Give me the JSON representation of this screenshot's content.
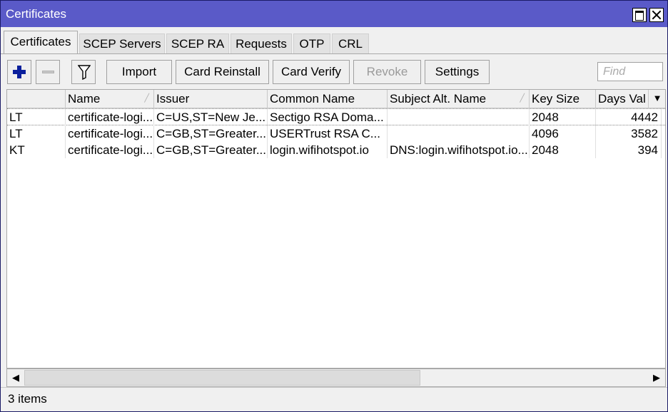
{
  "window": {
    "title": "Certificates"
  },
  "tabs": [
    {
      "label": "Certificates",
      "active": true
    },
    {
      "label": "SCEP Servers",
      "active": false
    },
    {
      "label": "SCEP RA",
      "active": false
    },
    {
      "label": "Requests",
      "active": false
    },
    {
      "label": "OTP",
      "active": false
    },
    {
      "label": "CRL",
      "active": false
    }
  ],
  "toolbar": {
    "add_icon": "plus-icon",
    "remove_icon": "minus-icon",
    "filter_icon": "filter-icon",
    "import_label": "Import",
    "card_reinstall_label": "Card Reinstall",
    "card_verify_label": "Card Verify",
    "revoke_label": "Revoke",
    "settings_label": "Settings",
    "find_placeholder": "Find"
  },
  "table": {
    "columns": [
      "",
      "Name",
      "Issuer",
      "Common Name",
      "Subject Alt. Name",
      "Key Size",
      "Days Val"
    ],
    "rows": [
      [
        "LT",
        "certificate-logi...",
        "C=US,ST=New Je...",
        "Sectigo RSA Doma...",
        "",
        "2048",
        "4442"
      ],
      [
        "LT",
        "certificate-logi...",
        "C=GB,ST=Greater...",
        "USERTrust RSA C...",
        "",
        "4096",
        "3582"
      ],
      [
        "KT",
        "certificate-logi...",
        "C=GB,ST=Greater...",
        "login.wifihotspot.io",
        "DNS:login.wifihotspot.io...",
        "2048",
        "394"
      ]
    ]
  },
  "status": {
    "items_text": "3 items"
  },
  "colors": {
    "titlebar": "#5a5ac8",
    "add_icon": "#0a1f9c"
  }
}
